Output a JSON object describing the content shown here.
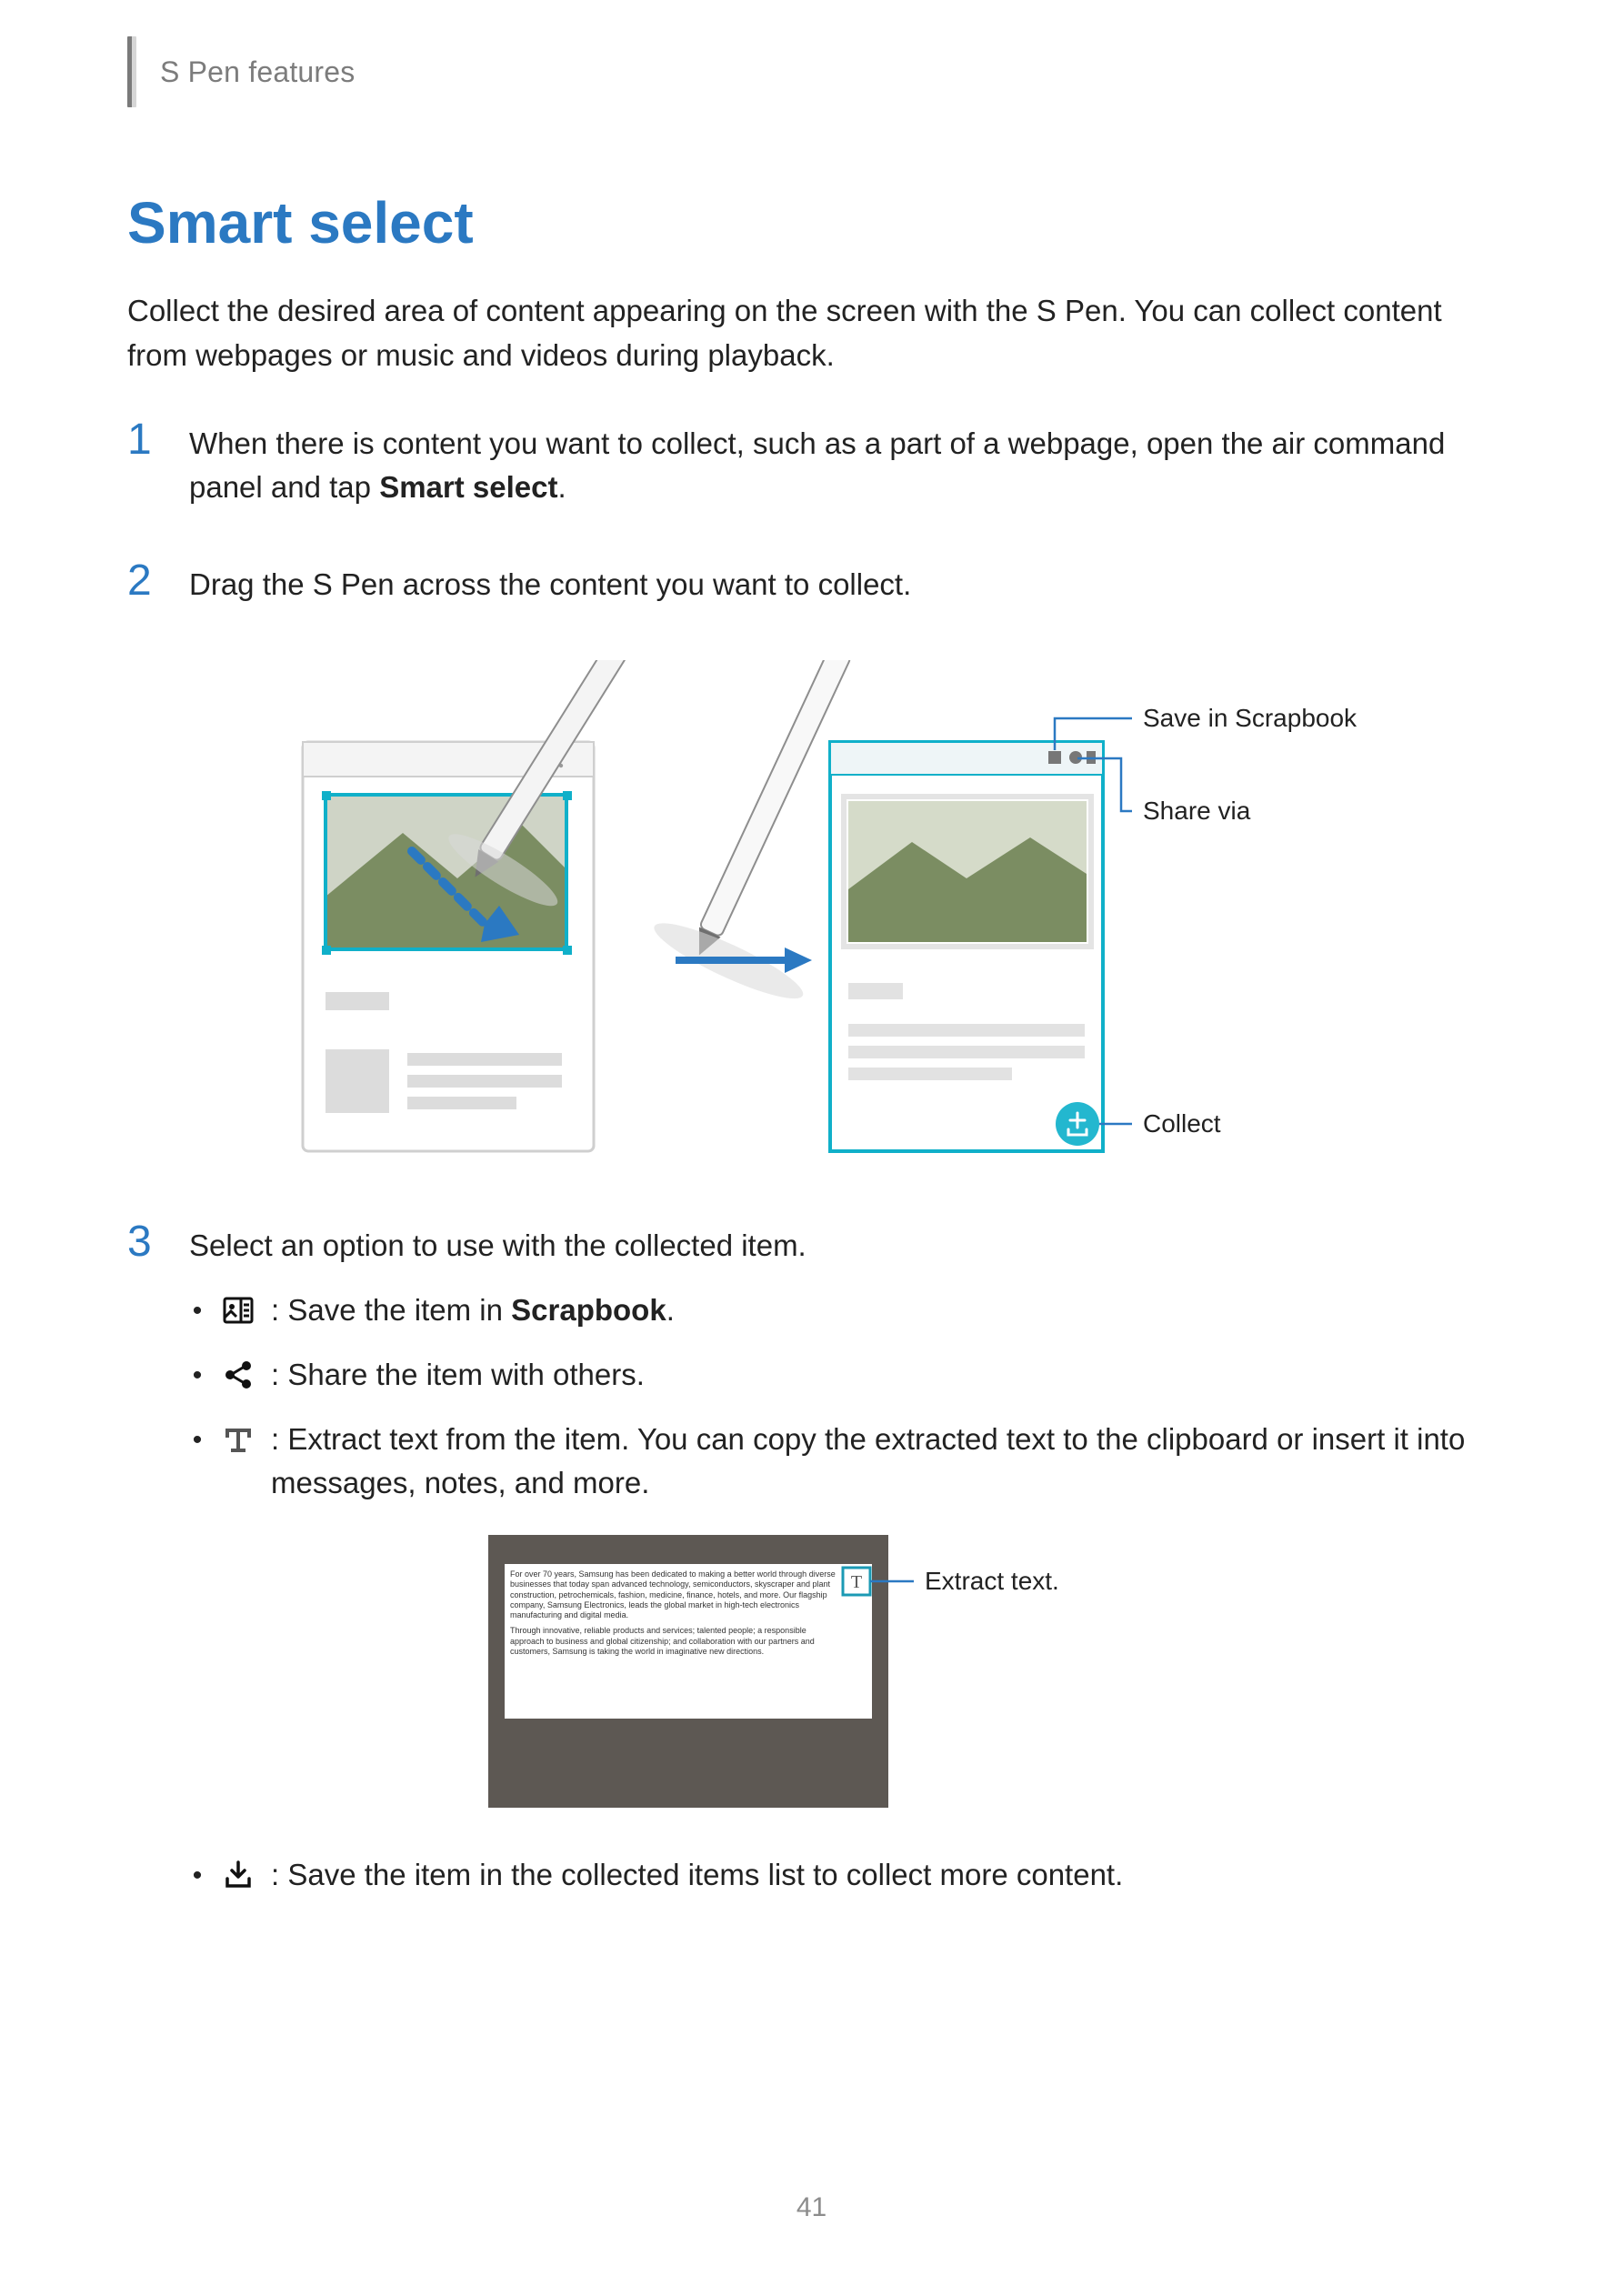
{
  "header": {
    "section": "S Pen features"
  },
  "title": "Smart select",
  "intro": "Collect the desired area of content appearing on the screen with the S Pen. You can collect content from webpages or music and videos during playback.",
  "steps": {
    "s1": {
      "num": "1",
      "text_a": "When there is content you want to collect, such as a part of a webpage, open the air command panel and tap ",
      "text_bold": "Smart select",
      "text_b": "."
    },
    "s2": {
      "num": "2",
      "text": "Drag the S Pen across the content you want to collect."
    },
    "s3": {
      "num": "3",
      "text": "Select an option to use with the collected item."
    }
  },
  "callouts": {
    "save_scrapbook": "Save in Scrapbook",
    "share_via": "Share via",
    "collect": "Collect",
    "extract_text": "Extract text."
  },
  "bullets": {
    "scrapbook": {
      "pre": " : Save the item in ",
      "bold": "Scrapbook",
      "post": "."
    },
    "share": " : Share the item with others.",
    "extract": " : Extract text from the item. You can copy the extracted text to the clipboard or insert it into messages, notes, and more.",
    "collect_more": " : Save the item in the collected items list to collect more content."
  },
  "icons": {
    "scrapbook": "scrapbook-icon",
    "share": "share-icon",
    "text": "text-icon",
    "download": "download-tray-icon"
  },
  "extract_panel": {
    "para1": "For over 70 years, Samsung has been dedicated to making a better world through diverse businesses that today span advanced technology, semiconductors, skyscraper and plant construction, petrochemicals, fashion, medicine, finance, hotels, and more. Our flagship company, Samsung Electronics, leads the global market in high-tech electronics manufacturing and digital media.",
    "para2": "Through innovative, reliable products and services; talented people; a responsible approach to business and global citizenship; and collaboration with our partners and customers, Samsung is taking the world in imaginative new directions.",
    "t_button": "T"
  },
  "page_number": "41",
  "colors": {
    "accent": "#2b79c2",
    "teal": "#10b0c9",
    "gray": "#b7b7b7"
  }
}
